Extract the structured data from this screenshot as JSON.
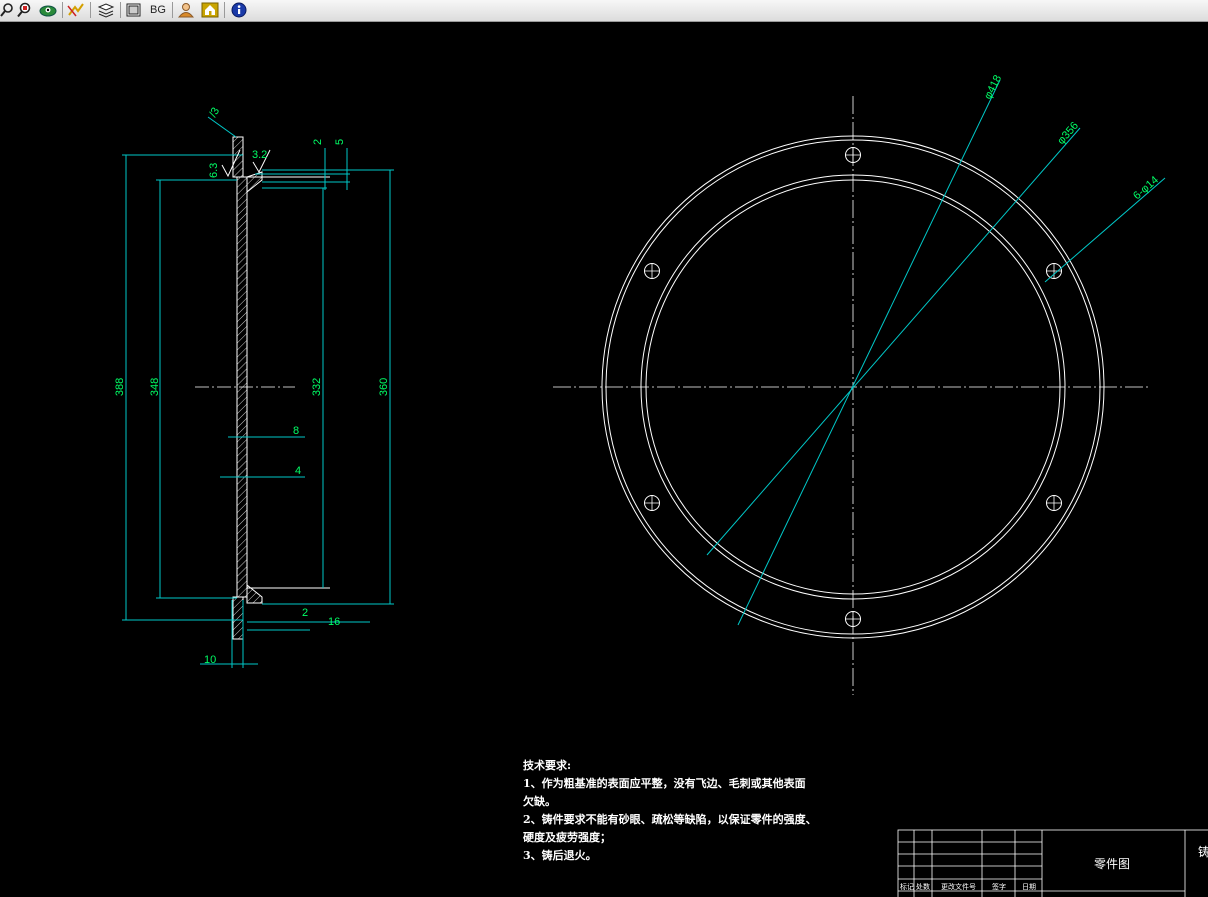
{
  "toolbar": {
    "buttons": [
      {
        "icon": "zoom-icon"
      },
      {
        "icon": "zoom-window-icon"
      },
      {
        "icon": "pan-icon"
      },
      {
        "icon": "trim-icon"
      },
      {
        "icon": "layers-icon"
      },
      {
        "icon": "frame-icon"
      },
      {
        "label": "BG"
      },
      {
        "icon": "user-icon"
      },
      {
        "icon": "home-icon"
      },
      {
        "icon": "info-icon"
      }
    ]
  },
  "drawing": {
    "colors": {
      "background": "#000000",
      "geometry": "#ffffff",
      "dimension": "#00c8c8",
      "dim_text": "#00ff66",
      "title_text": "#ffffff"
    },
    "section_view": {
      "dims": {
        "d388": "388",
        "d348": "348",
        "d332": "332",
        "d360": "360",
        "d8": "8",
        "d4": "4",
        "d2a": "2",
        "d5": "5",
        "d2b": "2",
        "d16": "16",
        "d10": "10"
      },
      "roughness": {
        "r1": "/3",
        "r2": "3.2",
        "r3": "6.3"
      }
    },
    "plan_view": {
      "dims": {
        "dia418": "φ418",
        "dia356": "φ356",
        "holes": "6-φ14"
      }
    },
    "notes": {
      "heading": "技术要求:",
      "line1": "1、作为粗基准的表面应平整，没有飞边、毛刺或其他表面",
      "line2": "欠缺。",
      "line3": "2、铸件要求不能有砂眼、疏松等缺陷，以保证零件的强度、",
      "line4": "硬度及疲劳强度；",
      "line5": "3、铸后退火。"
    },
    "title_block": {
      "name": "零件图",
      "headers": [
        "标记",
        "处数",
        "更改文件号",
        "签字",
        "日期"
      ],
      "right_edge": "铸"
    }
  }
}
